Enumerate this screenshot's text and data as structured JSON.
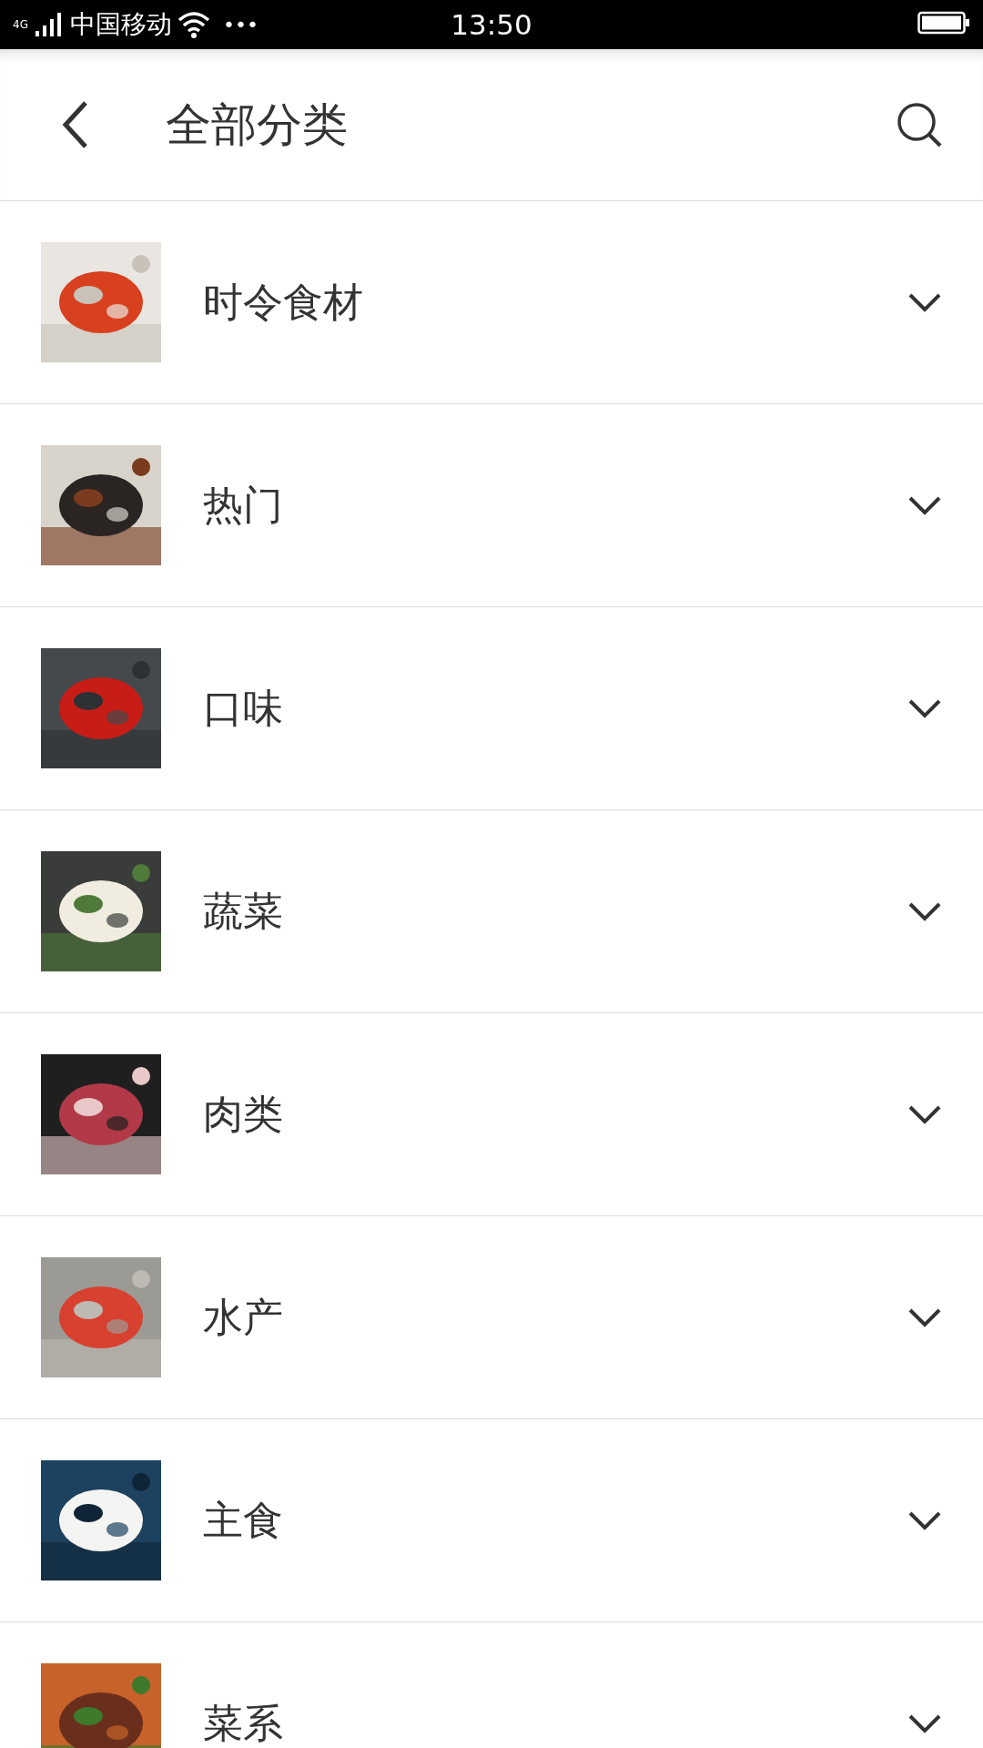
{
  "status_bar": {
    "network": "4G",
    "carrier": "中国移动",
    "more": "•••",
    "time": "13:50"
  },
  "header": {
    "title": "全部分类"
  },
  "categories": [
    {
      "label": "时令食材",
      "expanded": false
    },
    {
      "label": "热门",
      "expanded": false
    },
    {
      "label": "口味",
      "expanded": false
    },
    {
      "label": "蔬菜",
      "expanded": false
    },
    {
      "label": "肉类",
      "expanded": false
    },
    {
      "label": "水产",
      "expanded": false
    },
    {
      "label": "主食",
      "expanded": false
    },
    {
      "label": "菜系",
      "expanded": false
    }
  ]
}
